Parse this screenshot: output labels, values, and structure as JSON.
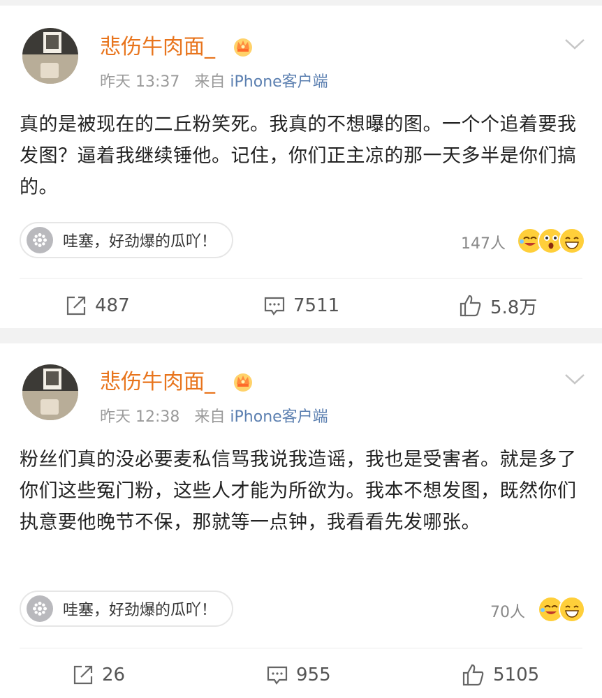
{
  "posts": [
    {
      "username": "悲伤牛肉面_",
      "time": "昨天 13:37",
      "source_prefix": "来自",
      "source": "iPhone客户端",
      "content": "真的是被现在的二丘粉笑死。我真的不想曝的图。一个个追着要我发图？逼着我继续锤他。记住，你们正主凉的那一天多半是你们搞的。",
      "reaction_prompt": "哇塞，好劲爆的瓜吖！",
      "reaction_count": "147人",
      "reaction_emojis": [
        "laugh-tears-icon",
        "surprised-icon",
        "grin-icon"
      ],
      "reposts": "487",
      "comments": "7511",
      "likes": "5.8万"
    },
    {
      "username": "悲伤牛肉面_",
      "time": "昨天 12:38",
      "source_prefix": "来自",
      "source": "iPhone客户端",
      "content": "粉丝们真的没必要麦私信骂我说我造谣，我也是受害者。就是多了你们这些冤门粉，这些人才能为所欲为。我本不想发图，既然你们执意要他晚节不保，那就等一点钟，我看看先发哪张。",
      "reaction_prompt": "哇塞，好劲爆的瓜吖！",
      "reaction_count": "70人",
      "reaction_emojis": [
        "laugh-tears-icon",
        "grin-icon"
      ],
      "reposts": "26",
      "comments": "955",
      "likes": "5105"
    }
  ],
  "colors": {
    "username": "#e8741c",
    "source_link": "#5b7fb0",
    "meta": "#9a9a9a",
    "text": "#222222",
    "page_bg": "#f2f2f2"
  }
}
